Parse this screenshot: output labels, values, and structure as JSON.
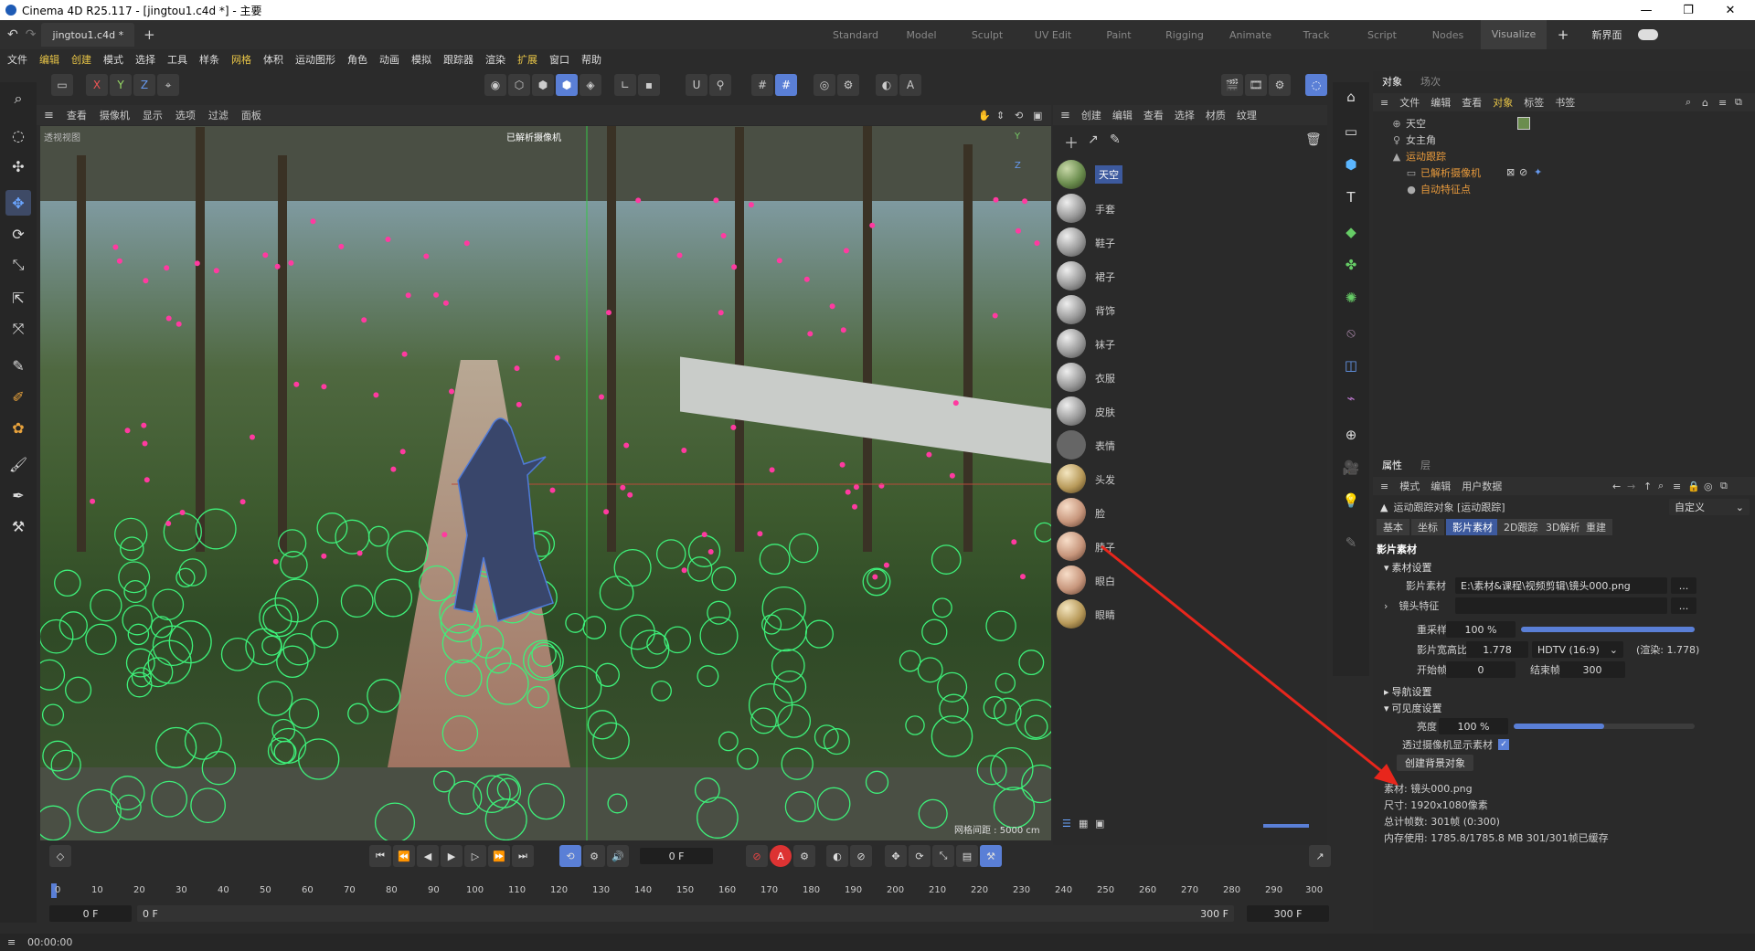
{
  "window": {
    "title": "Cinema 4D R25.117 - [jingtou1.c4d *] - 主要",
    "min": "—",
    "max": "❐",
    "close": "✕"
  },
  "tabs": {
    "doc": "jingtou1.c4d *",
    "add": "+"
  },
  "layouts": [
    "Standard",
    "Model",
    "Sculpt",
    "UV Edit",
    "Paint",
    "Rigging",
    "Animate",
    "Track",
    "Script",
    "Nodes",
    "Visualize"
  ],
  "layout_extra": {
    "plus": "+",
    "new_ui": "新界面"
  },
  "menu": [
    "文件",
    "编辑",
    "创建",
    "模式",
    "选择",
    "工具",
    "样条",
    "网格",
    "体积",
    "运动图形",
    "角色",
    "动画",
    "模拟",
    "跟踪器",
    "渲染",
    "扩展",
    "窗口",
    "帮助"
  ],
  "viewport": {
    "menu": [
      "查看",
      "摄像机",
      "显示",
      "选项",
      "过滤",
      "面板"
    ],
    "label": "透视视图",
    "camera": "已解析摄像机",
    "grid": "网格间距 : 5000 cm",
    "axis_y": "Y",
    "axis_z": "Z"
  },
  "material": {
    "menu": [
      "创建",
      "编辑",
      "查看",
      "选择",
      "材质",
      "纹理"
    ],
    "items": [
      "天空",
      "手套",
      "鞋子",
      "裙子",
      "背饰",
      "袜子",
      "衣服",
      "皮肤",
      "表情",
      "头发",
      "脸",
      "脖子",
      "眼白",
      "眼睛"
    ]
  },
  "objects": {
    "tabs": [
      "对象",
      "场次"
    ],
    "menu": [
      "文件",
      "编辑",
      "查看",
      "对象",
      "标签",
      "书签"
    ],
    "items": [
      "天空",
      "女主角",
      "运动跟踪",
      "已解析摄像机",
      "自动特征点"
    ]
  },
  "attributes": {
    "tabs": [
      "属性",
      "层"
    ],
    "menu": [
      "模式",
      "编辑",
      "用户数据"
    ],
    "object_title": "运动跟踪对象 [运动跟踪]",
    "preset": "自定义",
    "subtabs": [
      "基本",
      "坐标",
      "影片素材",
      "2D跟踪",
      "3D解析",
      "重建"
    ],
    "section": "影片素材",
    "group_footage": "素材设置",
    "footage_label": "影片素材",
    "footage_path": "E:\\素材&课程\\视频剪辑\\镜头000.png",
    "lens_label": "镜头特征",
    "resample_label": "重采样",
    "resample_value": "100 %",
    "resample_level": 1.0,
    "aspect_label": "影片宽高比",
    "aspect_value": "1.778",
    "aspect_select": "HDTV (16:9)",
    "render_ratio": "(渲染: 1.778)",
    "start_label": "开始帧",
    "start_value": "0",
    "end_label": "结束帧",
    "end_value": "300",
    "group_nav": "导航设置",
    "group_vis": "可见度设置",
    "brightness_label": "亮度",
    "brightness_value": "100 %",
    "brightness_level": 0.5,
    "show_through_label": "透过摄像机显示素材",
    "create_bg": "创建背景对象",
    "info": [
      "素材: 镜头000.png",
      "尺寸: 1920x1080像素",
      "总计帧数: 301帧 (0:300)",
      "内存使用: 1785.8/1785.8 MB 301/301帧已缓存"
    ],
    "dots": "..."
  },
  "timeline": {
    "current": "0 F",
    "ruler": [
      "0",
      "10",
      "20",
      "30",
      "40",
      "50",
      "60",
      "70",
      "80",
      "90",
      "100",
      "110",
      "120",
      "130",
      "140",
      "150",
      "160",
      "170",
      "180",
      "190",
      "200",
      "210",
      "220",
      "230",
      "240",
      "250",
      "260",
      "270",
      "280",
      "290",
      "300"
    ],
    "start": "0 F",
    "start2": "0 F",
    "end": "300 F",
    "end2": "300 F"
  },
  "status": {
    "time": "00:00:00"
  }
}
